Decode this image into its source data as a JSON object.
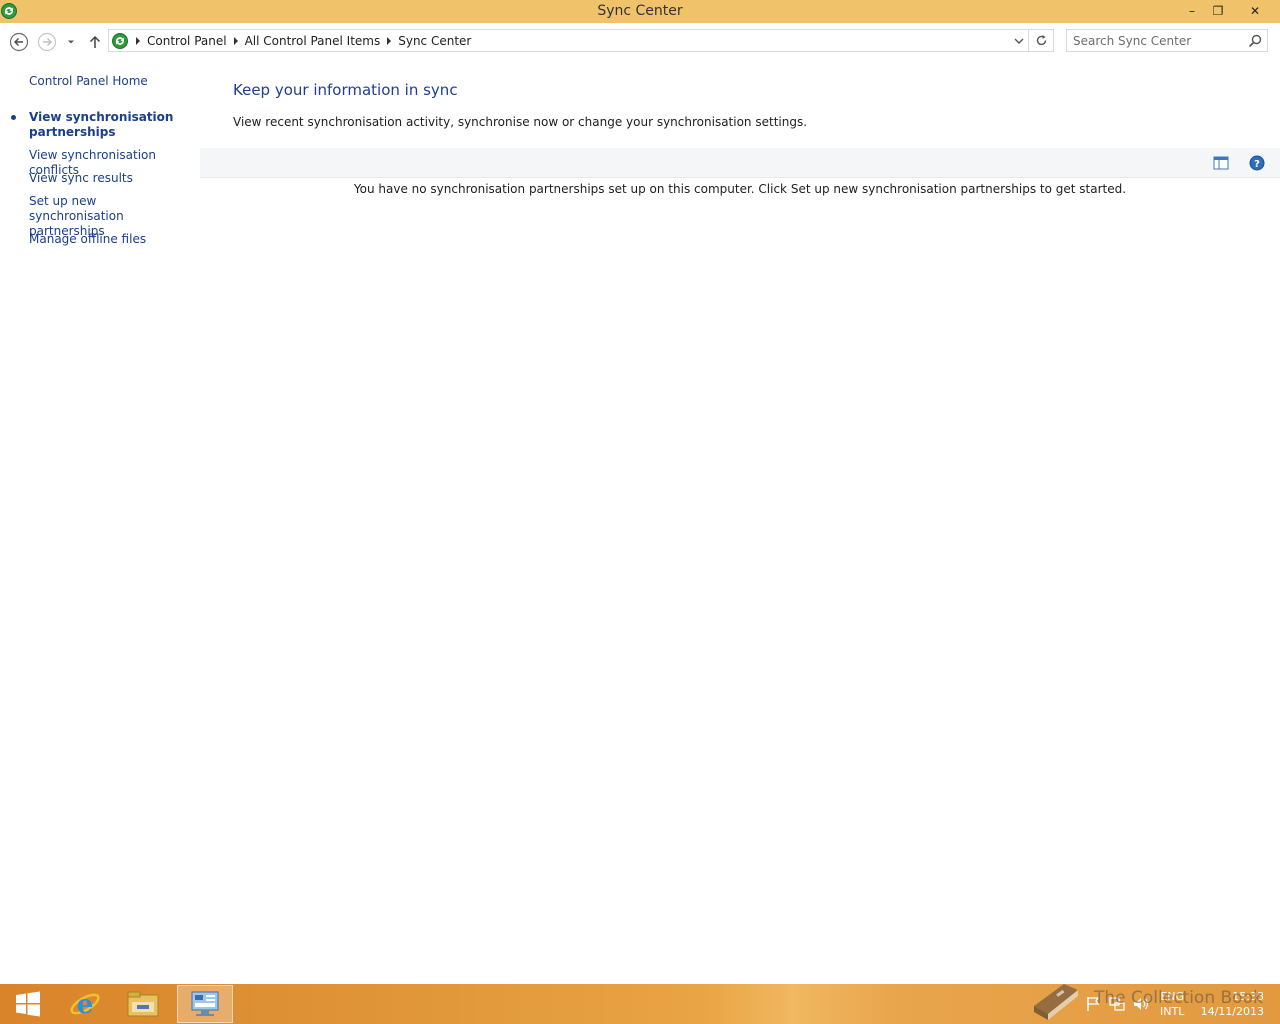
{
  "window": {
    "title": "Sync Center",
    "controls": {
      "minimize": "–",
      "restore": "❐",
      "close": "✕"
    }
  },
  "address": {
    "breadcrumbs": [
      "Control Panel",
      "All Control Panel Items",
      "Sync Center"
    ],
    "search_placeholder": "Search Sync Center"
  },
  "sidebar": {
    "home": "Control Panel Home",
    "items": [
      {
        "label": "View synchronisation partnerships",
        "active": true
      },
      {
        "label": "View synchronisation conflicts",
        "active": false
      },
      {
        "label": "View sync results",
        "active": false
      },
      {
        "label": "Set up new synchronisation partnerships",
        "active": false
      },
      {
        "label": "Manage offline files",
        "active": false
      }
    ]
  },
  "main": {
    "heading": "Keep your information in sync",
    "subtitle": "View recent synchronisation activity, synchronise now or change your synchronisation settings.",
    "empty_message": "You have no synchronisation partnerships set up on this computer. Click Set up new synchronisation partnerships to get started."
  },
  "taskbar": {
    "apps": [
      "start-icon",
      "internet-explorer-icon",
      "file-explorer-icon",
      "control-panel-icon"
    ],
    "language": {
      "line1": "ENG",
      "line2": "INTL"
    },
    "time": "15:33",
    "date": "14/11/2013"
  },
  "watermark": {
    "text": "The Collection Book"
  },
  "colors": {
    "titlebar": "#f0c36b",
    "link": "#1a3f8b",
    "heading": "#1e3f91",
    "taskbar": "#e29b3d"
  }
}
